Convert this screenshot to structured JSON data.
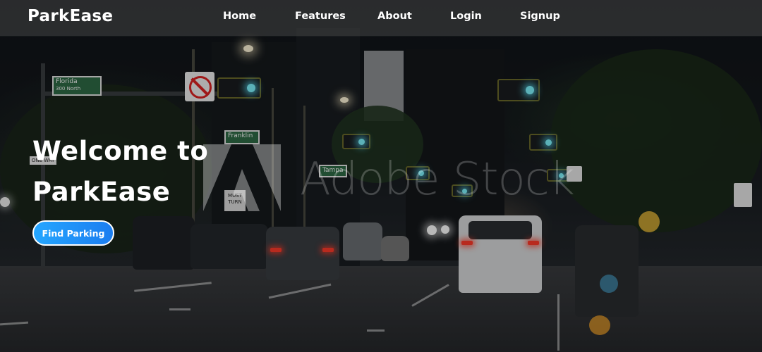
{
  "brand": {
    "name": "ParkEase"
  },
  "nav": {
    "items": [
      {
        "label": "Home"
      },
      {
        "label": "Features"
      },
      {
        "label": "About"
      },
      {
        "label": "Login"
      },
      {
        "label": "Signup"
      }
    ]
  },
  "hero": {
    "title_line1": "Welcome to",
    "title_line2": "ParkEase",
    "cta_label": "Find Parking"
  },
  "background": {
    "watermark": "Adobe Stock",
    "signs": {
      "florida": "Florida",
      "florida_sub": "300 North",
      "franklin": "Franklin",
      "tampa": "Tampa",
      "must": "MUST",
      "must_sub": "TURN",
      "one_way": "ONE WAY"
    }
  },
  "colors": {
    "nav_bg": "#464646",
    "accent": "#1b7df0",
    "accent_light": "#25a6ff",
    "text": "#ffffff"
  }
}
